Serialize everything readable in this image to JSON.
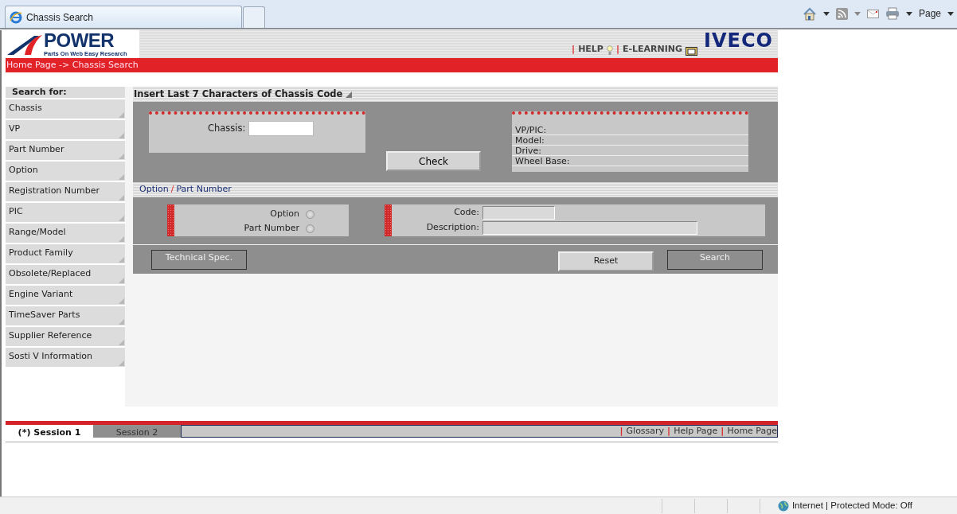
{
  "browser": {
    "tab_title": "Chassis Search",
    "page_menu": "Page"
  },
  "header": {
    "logo_name": "POWER",
    "logo_tagline": "Parts On Web Easy Research",
    "links": [
      "HELP",
      "E-LEARNING"
    ],
    "link_separator": "|",
    "brand": "IVECO"
  },
  "breadcrumb": "Home Page -> Chassis Search",
  "sidebar": {
    "title": "Search for:",
    "items": [
      "Chassis",
      "VP",
      "Part Number",
      "Option",
      "Registration Number",
      "PIC",
      "Range/Model",
      "Product Family",
      "Obsolete/Replaced",
      "Engine Variant",
      "TimeSaver Parts",
      "Supplier Reference",
      "Sosti V Information"
    ]
  },
  "chassis_section": {
    "title": "Insert Last 7 Characters of Chassis Code",
    "chassis_label": "Chassis:",
    "check_button": "Check",
    "info_fields": [
      "VP/PIC:",
      "Model:",
      "Drive:",
      "Wheel Base:"
    ]
  },
  "option_section": {
    "tabs": [
      "Option",
      "Part Number"
    ],
    "separator": "/",
    "radios": [
      {
        "label": "Option",
        "checked": false
      },
      {
        "label": "Part Number",
        "checked": false
      }
    ],
    "fields": [
      "Code:",
      "Description:"
    ]
  },
  "buttons": [
    {
      "label": "Technical Spec.",
      "kind": "flat"
    },
    {
      "label": "Reset",
      "kind": "raised"
    },
    {
      "label": "Search",
      "kind": "flat"
    }
  ],
  "sessions": [
    {
      "label": "(*) Session 1",
      "selected": true
    },
    {
      "label": "Session 2",
      "selected": false
    }
  ],
  "footer_links": [
    "Glossary",
    "Help Page",
    "Home Page"
  ],
  "footer_separator": "|",
  "status_bar": {
    "zone": "Internet",
    "separator": "|",
    "mode": "Protected Mode: Off"
  }
}
